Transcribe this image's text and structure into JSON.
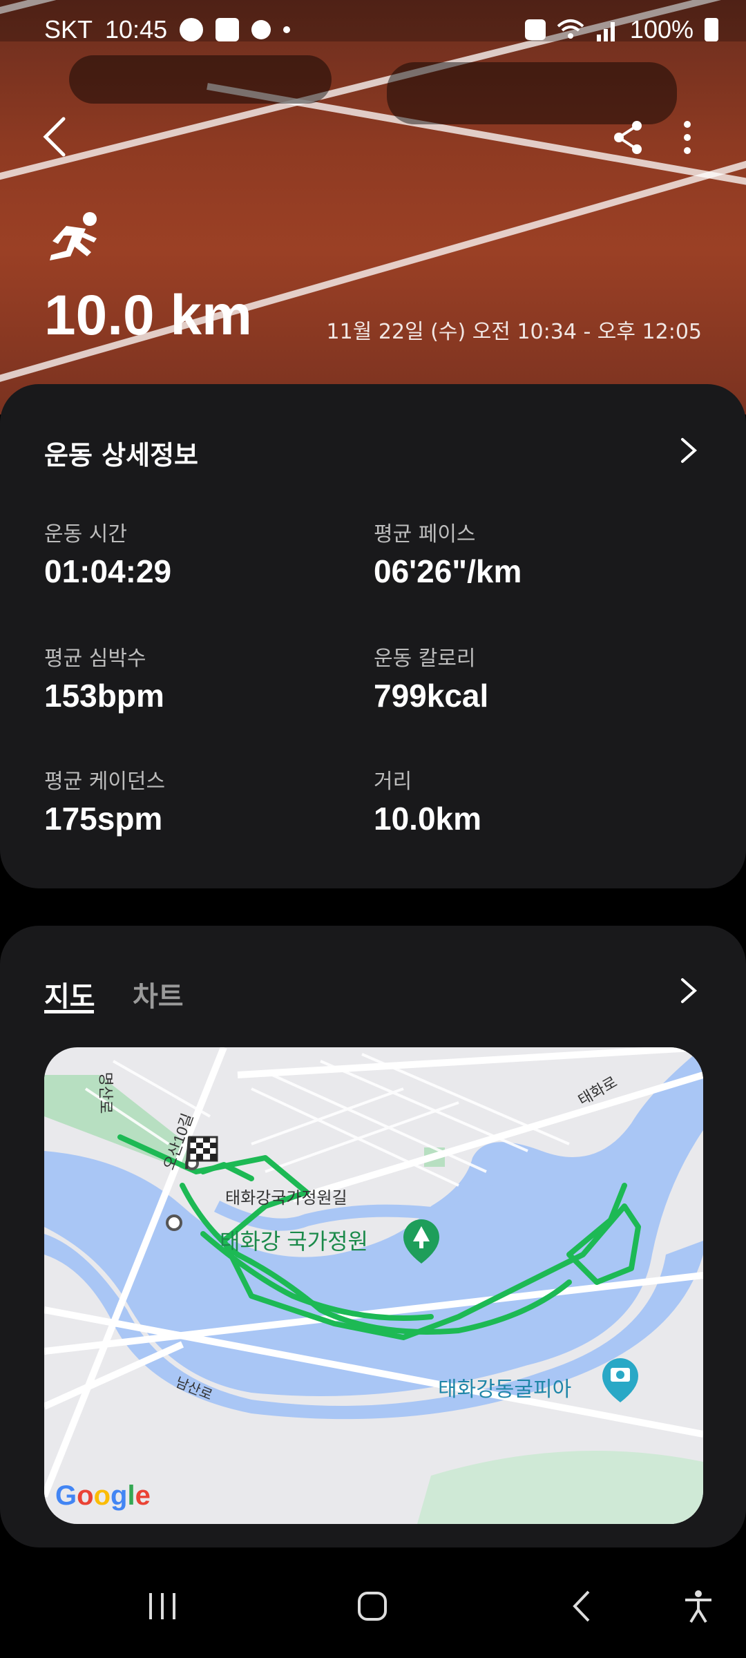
{
  "status_bar": {
    "carrier": "SKT",
    "time": "10:45",
    "battery": "100%",
    "icons": [
      "sync-icon",
      "sim-icon",
      "alarm-icon",
      "dot-icon",
      "mute-icon",
      "wifi-icon",
      "signal-icon",
      "battery-icon"
    ]
  },
  "header": {
    "activity_icon": "running-icon",
    "distance": "10.0 km",
    "date_range": "11월 22일 (수) 오전 10:34 - 오후 12:05"
  },
  "details": {
    "title": "운동 상세정보",
    "stats": [
      {
        "label": "운동 시간",
        "value": "01:04:29"
      },
      {
        "label": "평균 페이스",
        "value": "06'26\"/km"
      },
      {
        "label": "평균 심박수",
        "value": "153bpm"
      },
      {
        "label": "운동 칼로리",
        "value": "799kcal"
      },
      {
        "label": "평균 케이던스",
        "value": "175spm"
      },
      {
        "label": "거리",
        "value": "10.0km"
      }
    ]
  },
  "map_card": {
    "tabs": [
      {
        "label": "지도"
      },
      {
        "label": "차트"
      }
    ],
    "active_tab": "지도",
    "map_labels": {
      "park": "태화강 국가정원",
      "street1": "태화강국가정원길",
      "street2": "오산10길",
      "street3": "태화로",
      "street4": "남산로",
      "street5": "명산로",
      "poi": "태화강동굴피아"
    },
    "attribution": "Google"
  },
  "nav_bar": {
    "buttons": [
      "recent-apps-icon",
      "home-icon",
      "back-icon",
      "accessibility-icon"
    ]
  },
  "colors": {
    "card_bg": "#19191b",
    "route": "#1db954",
    "water": "#a9c6f5",
    "park": "#b7dfc1"
  }
}
